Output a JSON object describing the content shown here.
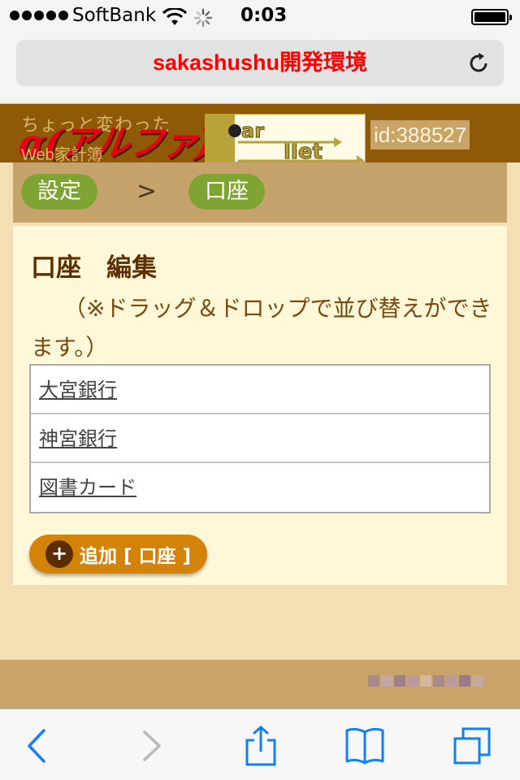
{
  "status_bar": {
    "carrier": "SoftBank",
    "time": "0:03",
    "signal_bars": 5,
    "battery_level": 1.0
  },
  "address_bar": {
    "title": "sakashushu開発環境",
    "title_color": "#ff0000",
    "reload_icon": "reload-icon"
  },
  "site_header": {
    "tagline": "ちょっと変わった",
    "subtitle": "Web家計簿",
    "logo_text": "α(アルファ)版",
    "pallet_logo_text": "Pallet",
    "user_id": "id:388527"
  },
  "breadcrumb": {
    "items": [
      {
        "label": "設定"
      },
      {
        "label": "口座"
      }
    ],
    "separator": ">"
  },
  "panel": {
    "title": "口座　編集",
    "note": "（※ドラッグ＆ドロップで並び替えができます。）",
    "accounts": [
      {
        "name": "大宮銀行"
      },
      {
        "name": "神宮銀行"
      },
      {
        "name": "図書カード"
      }
    ],
    "add_button_icon": "+",
    "add_button_label": "追加 [ 口座 ]"
  },
  "toolbar": {
    "buttons": [
      "back-icon",
      "forward-icon",
      "share-icon",
      "bookmarks-icon",
      "tabs-icon"
    ]
  },
  "colors": {
    "page_bg": "#f4dfb4",
    "header_bg": "#8f5a08",
    "crumb_green": "#7ea534",
    "add_button": "#d4830a",
    "ios_blue": "#157efb"
  }
}
